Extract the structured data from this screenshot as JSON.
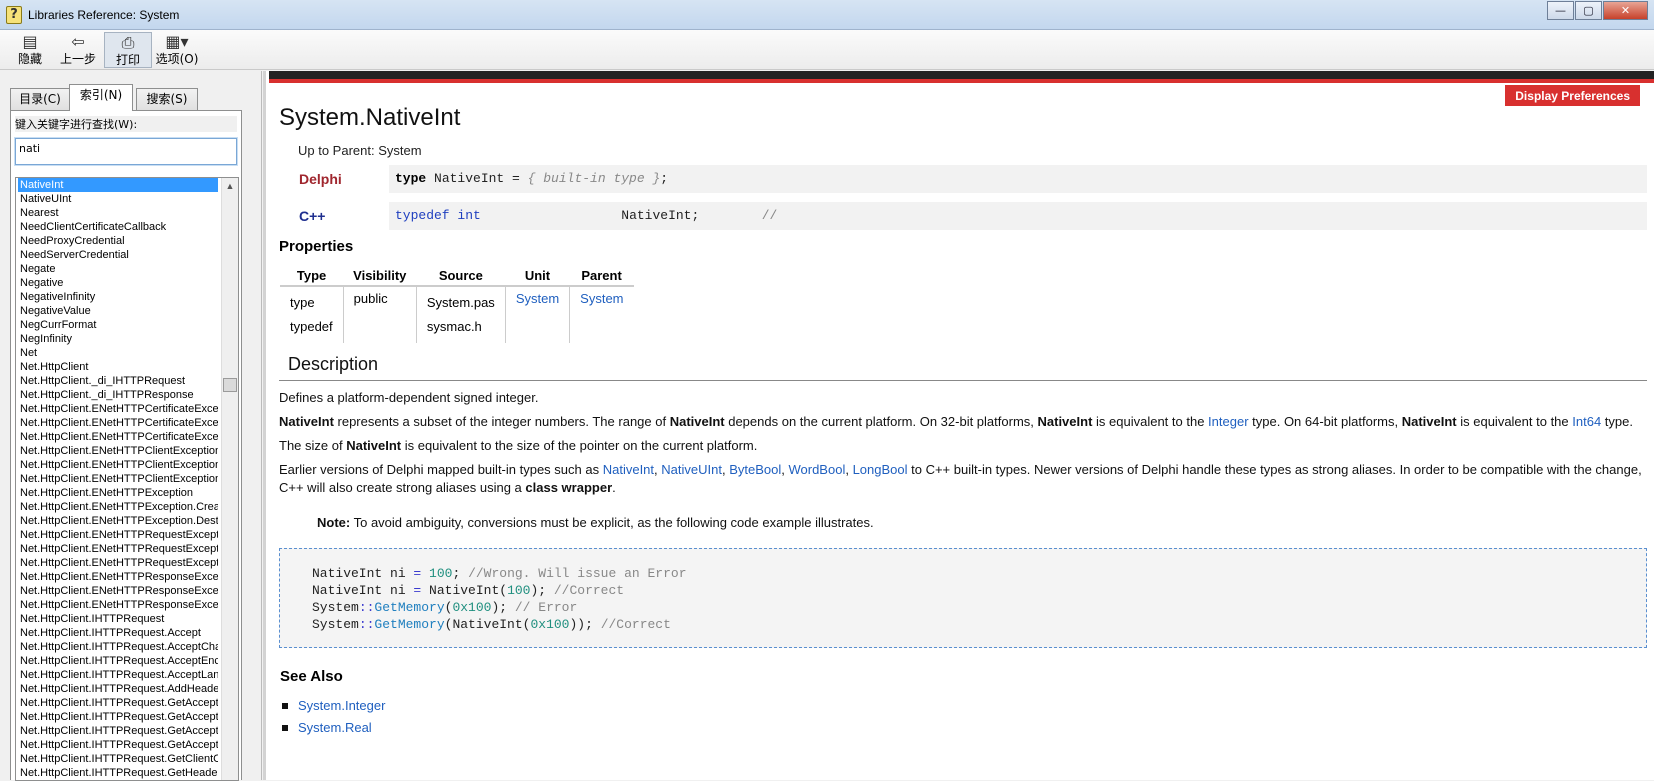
{
  "window": {
    "title": "Libraries Reference: System",
    "min_label": "—",
    "max_label": "▢",
    "close_label": "✕"
  },
  "toolbar": {
    "hide_label": "隐藏",
    "back_label": "上一步",
    "print_label": "打印",
    "options_label": "选项(O)"
  },
  "left": {
    "tabs": [
      "目录(C)",
      "索引(N)",
      "搜索(S)"
    ],
    "keyword_label": "键入关键字进行查找(W):",
    "keyword_value": "nati",
    "index_items": [
      "NativeInt",
      "NativeUInt",
      "Nearest",
      "NeedClientCertificateCallback",
      "NeedProxyCredential",
      "NeedServerCredential",
      "Negate",
      "Negative",
      "NegativeInfinity",
      "NegativeValue",
      "NegCurrFormat",
      "NegInfinity",
      "Net",
      "Net.HttpClient",
      "Net.HttpClient._di_IHTTPRequest",
      "Net.HttpClient._di_IHTTPResponse",
      "Net.HttpClient.ENetHTTPCertificateExceptio",
      "Net.HttpClient.ENetHTTPCertificateExceptio",
      "Net.HttpClient.ENetHTTPCertificateExceptio",
      "Net.HttpClient.ENetHTTPClientException",
      "Net.HttpClient.ENetHTTPClientException.Cr",
      "Net.HttpClient.ENetHTTPClientException.De",
      "Net.HttpClient.ENetHTTPException",
      "Net.HttpClient.ENetHTTPException.Create",
      "Net.HttpClient.ENetHTTPException.Destroy",
      "Net.HttpClient.ENetHTTPRequestException",
      "Net.HttpClient.ENetHTTPRequestException",
      "Net.HttpClient.ENetHTTPRequestException",
      "Net.HttpClient.ENetHTTPResponseExceptio",
      "Net.HttpClient.ENetHTTPResponseExceptio",
      "Net.HttpClient.ENetHTTPResponseExceptio",
      "Net.HttpClient.IHTTPRequest",
      "Net.HttpClient.IHTTPRequest.Accept",
      "Net.HttpClient.IHTTPRequest.AcceptCharS",
      "Net.HttpClient.IHTTPRequest.AcceptEncod",
      "Net.HttpClient.IHTTPRequest.AcceptLangu",
      "Net.HttpClient.IHTTPRequest.AddHeader",
      "Net.HttpClient.IHTTPRequest.GetAccept",
      "Net.HttpClient.IHTTPRequest.GetAcceptCh",
      "Net.HttpClient.IHTTPRequest.GetAcceptEn",
      "Net.HttpClient.IHTTPRequest.GetAcceptLa",
      "Net.HttpClient.IHTTPRequest.GetClientCert",
      "Net.HttpClient.IHTTPRequest.GetHeaders"
    ]
  },
  "doc": {
    "display_prefs": "Display Preferences",
    "title": "System.NativeInt",
    "up_to_parent": "Up to Parent: System",
    "delphi_lang": "Delphi",
    "delphi_kw": "type",
    "delphi_rest": " NativeInt = ",
    "delphi_comment": "{ built-in type }",
    "delphi_end": ";",
    "cpp_lang": "C++",
    "cpp_kw1": "typedef",
    "cpp_kw2": "int",
    "cpp_name": "NativeInt;",
    "cpp_comment": "//",
    "properties_heading": "Properties",
    "props_headers": [
      "Type",
      "Visibility",
      "Source",
      "Unit",
      "Parent"
    ],
    "props_type": [
      "type",
      "typedef"
    ],
    "props_visibility": "public",
    "props_source": [
      "System.pas",
      "sysmac.h"
    ],
    "props_unit": "System",
    "props_parent": "System",
    "description_heading": "Description",
    "p1": "Defines a platform-dependent signed integer.",
    "p2": {
      "b1": "NativeInt",
      "t1": " represents a subset of the integer numbers. The range of ",
      "b2": "NativeInt",
      "t2": " depends on the current platform. On 32-bit platforms, ",
      "b3": "NativeInt",
      "t3": " is equivalent to the ",
      "l1": "Integer",
      "t4": " type. On 64-bit platforms, ",
      "b4": "NativeInt",
      "t5": " is equivalent to the ",
      "l2": "Int64",
      "t6": " type."
    },
    "p3": {
      "t1": "The size of ",
      "b1": "NativeInt",
      "t2": " is equivalent to the size of the pointer on the current platform."
    },
    "p4": {
      "t1": "Earlier versions of Delphi mapped built-in types such as ",
      "l1": "NativeInt",
      "l2": "NativeUInt",
      "l3": "ByteBool",
      "l4": "WordBool",
      "l5": "LongBool",
      "t2": " to C++ built-in types. Newer versions of Delphi handle these types as strong aliases. In order to be compatible with the change, C++ will also create strong aliases using a ",
      "b1": "class wrapper",
      "t3": "."
    },
    "note_label": "Note:",
    "note_text": " To avoid ambiguity, conversions must be explicit, as the following code example illustrates.",
    "code": {
      "l1a": "NativeInt ni ",
      "l1b": "=",
      "l1c": " ",
      "l1d": "100",
      "l1e": "; ",
      "l1f": "//Wrong. Will issue an Error",
      "l2a": "NativeInt ni ",
      "l2b": "=",
      "l2c": " NativeInt(",
      "l2d": "100",
      "l2e": "); ",
      "l2f": "//Correct",
      "l3a": "System",
      "l3b": "::",
      "l3c": "GetMemory",
      "l3d": "(",
      "l3e": "0x100",
      "l3f": "); ",
      "l3g": "// Error",
      "l4a": "System",
      "l4b": "::",
      "l4c": "GetMemory",
      "l4d": "(NativeInt(",
      "l4e": "0x100",
      "l4f": ")); ",
      "l4g": "//Correct"
    },
    "see_also_heading": "See Also",
    "see_also": [
      "System.Integer",
      "System.Real"
    ]
  },
  "colors": {
    "accent_red": "#d8302f",
    "link_blue": "#1f5fbf",
    "selection": "#3399ff"
  }
}
